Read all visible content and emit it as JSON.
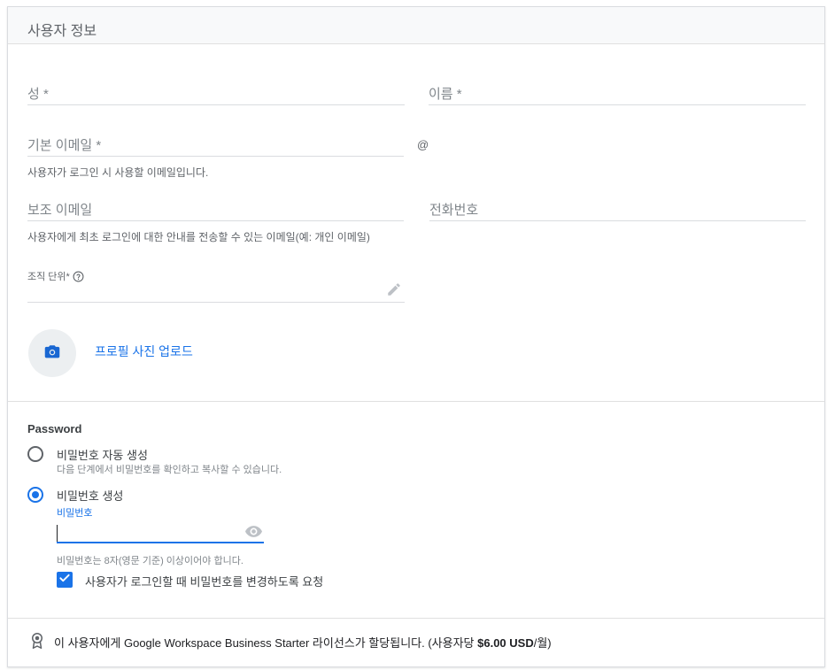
{
  "header": {
    "title": "사용자 정보"
  },
  "fields": {
    "last_name": {
      "placeholder": "성 *"
    },
    "first_name": {
      "placeholder": "이름 *"
    },
    "primary_email": {
      "placeholder": "기본 이메일 *",
      "hint": "사용자가 로그인 시 사용할 이메일입니다.",
      "domain_prefix": "@"
    },
    "secondary_email": {
      "placeholder": "보조 이메일",
      "hint": "사용자에게 최초 로그인에 대한 안내를 전송할 수 있는 이메일(예: 개인 이메일)"
    },
    "phone": {
      "placeholder": "전화번호"
    },
    "org_unit": {
      "label": "조직 단위*"
    }
  },
  "photo": {
    "upload_label": "프로필 사진 업로드"
  },
  "password": {
    "section_title": "Password",
    "auto_option": {
      "label": "비밀번호 자동 생성",
      "sub": "다음 단계에서 비밀번호를 확인하고 복사할 수 있습니다.",
      "selected": false
    },
    "create_option": {
      "label": "비밀번호 생성",
      "selected": true
    },
    "field_label": "비밀번호",
    "value": "",
    "requirement": "비밀번호는 8자(영문 기준) 이상이어야 합니다.",
    "require_change": {
      "label": "사용자가 로그인할 때 비밀번호를 변경하도록 요청",
      "checked": true
    }
  },
  "license": {
    "text_before": "이 사용자에게 Google Workspace Business Starter 라이선스가 할당됩니다. (사용자당 ",
    "price": "$6.00 USD",
    "text_after": "/월)"
  },
  "colors": {
    "accent": "#1a73e8",
    "text_secondary": "#5f6368",
    "divider": "#e0e0e0"
  },
  "icons": [
    "help-icon",
    "pencil-icon",
    "camera-icon",
    "eye-icon",
    "check-icon",
    "license-badge-icon"
  ]
}
